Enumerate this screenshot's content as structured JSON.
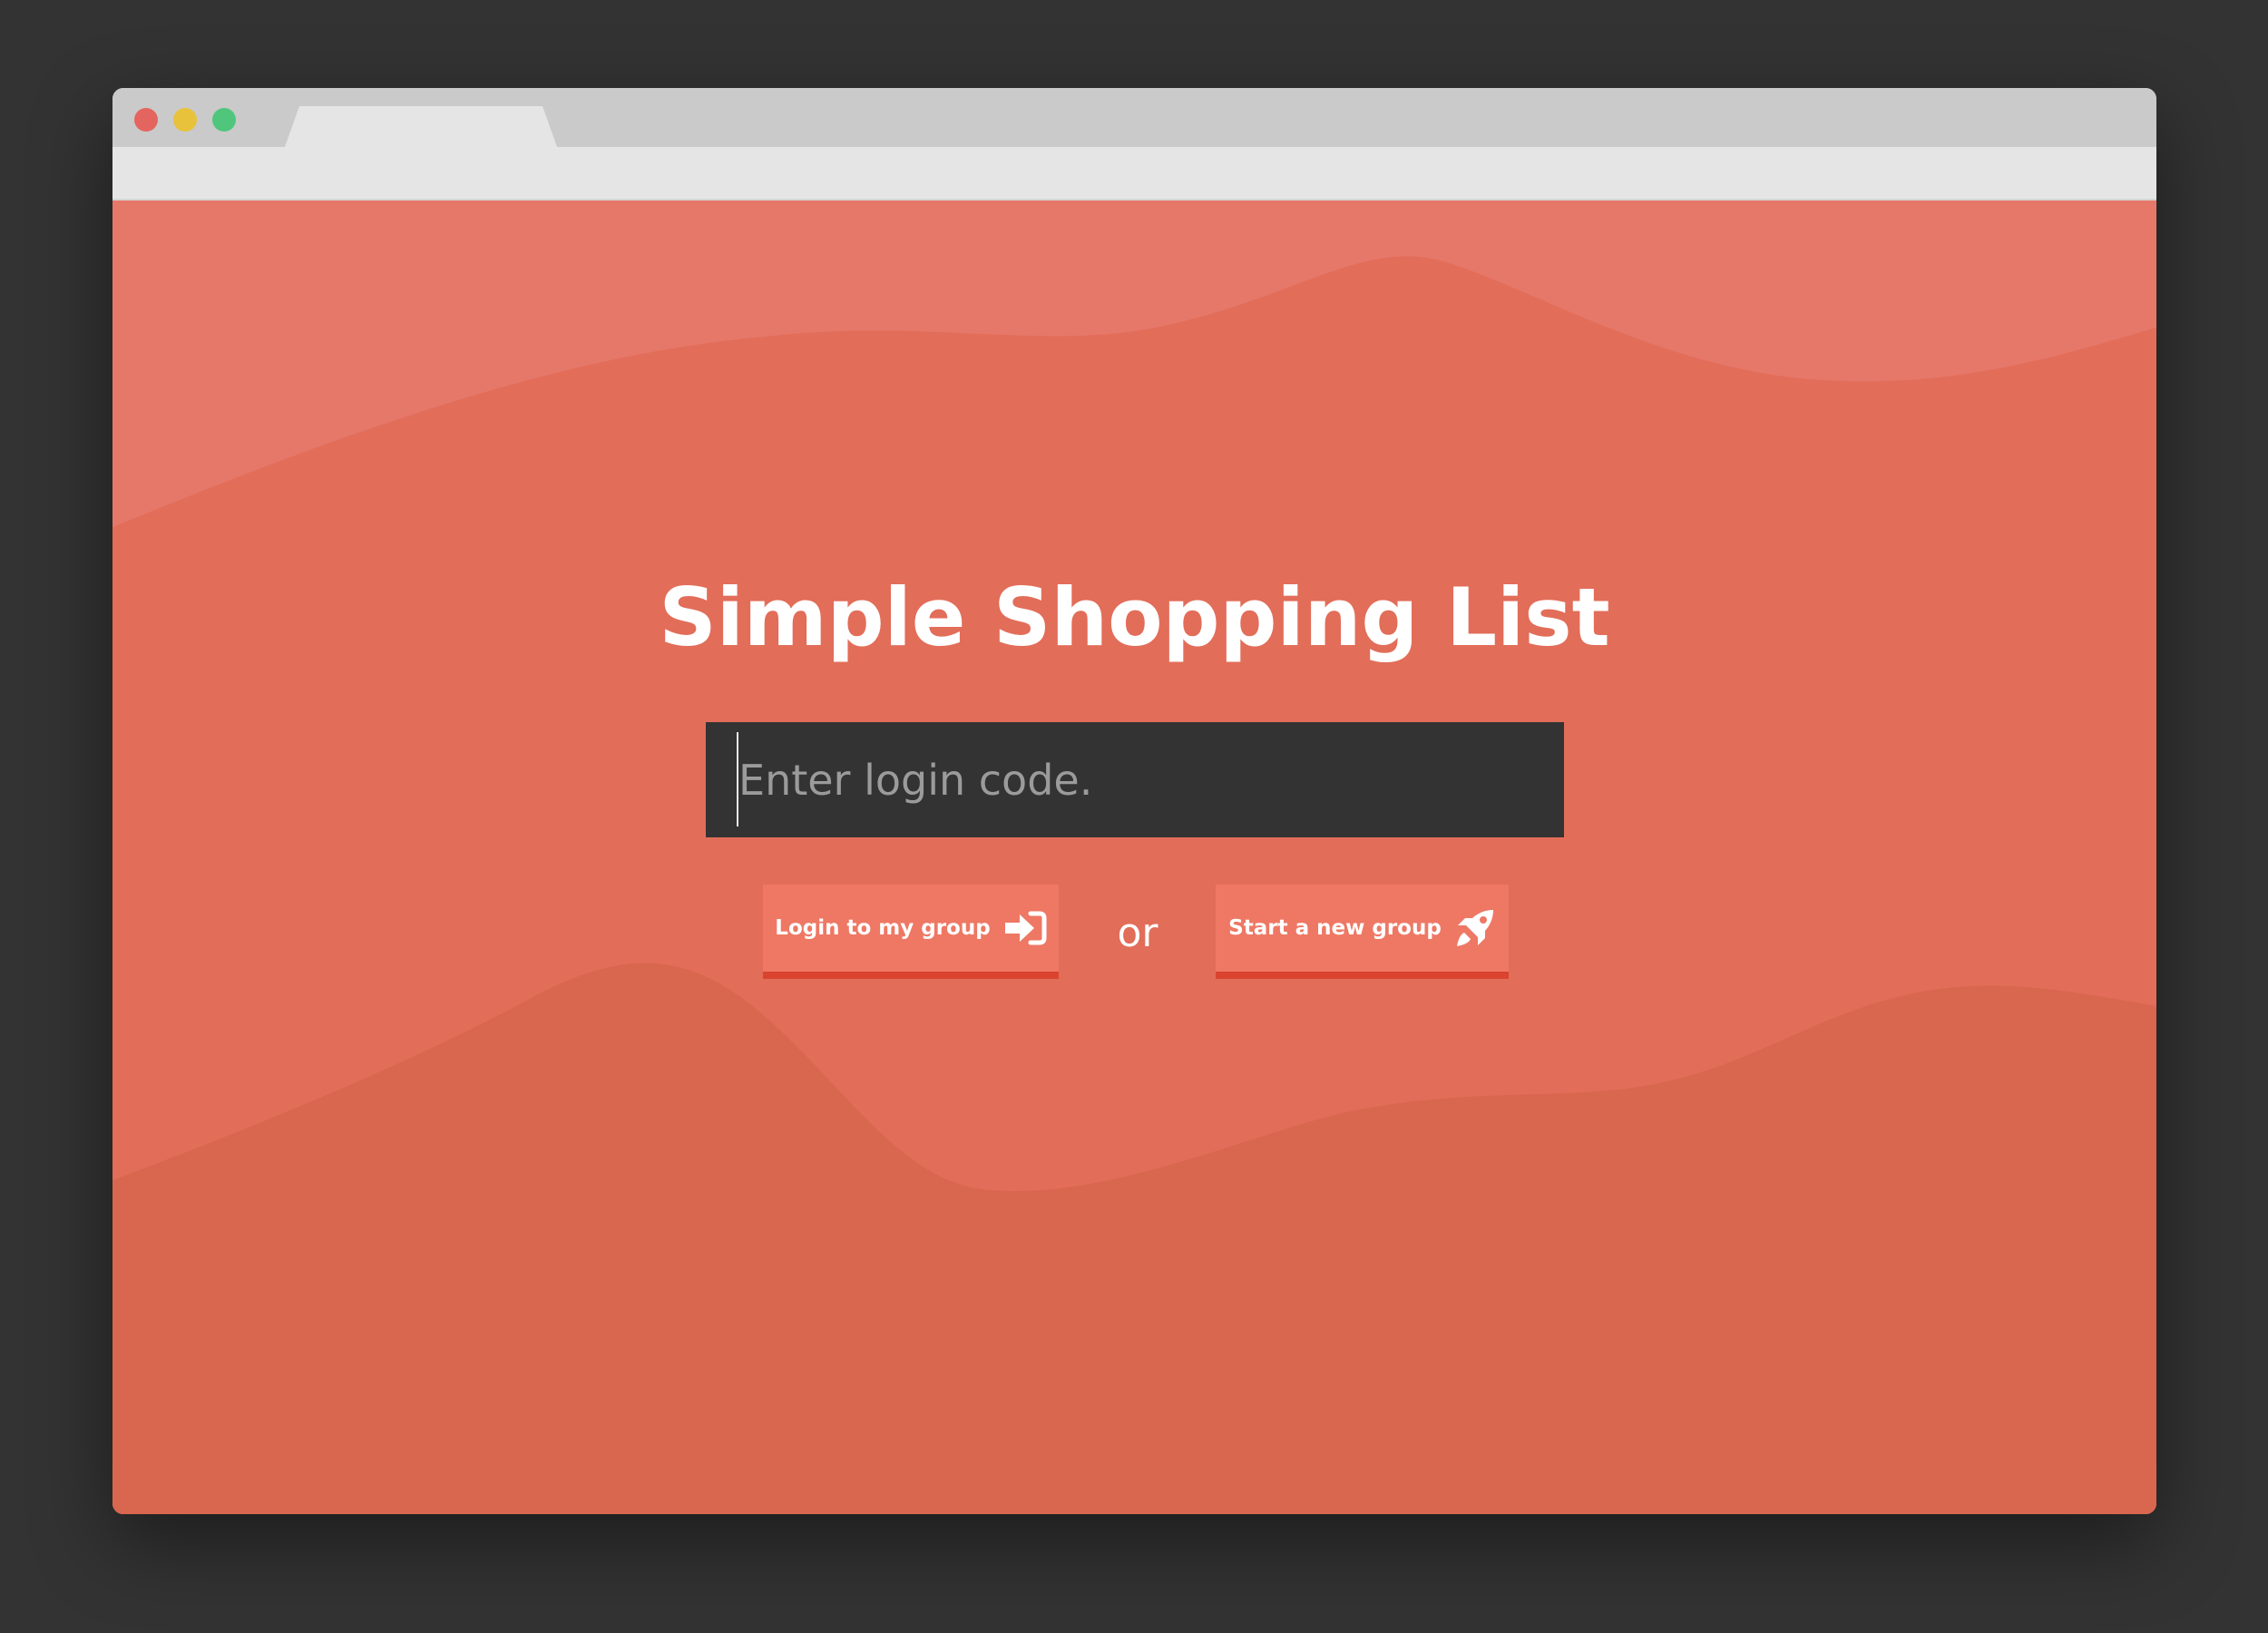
{
  "window": {
    "traffic_lights": [
      "close",
      "minimize",
      "zoom"
    ],
    "colors": {
      "close": "#e4655f",
      "minimize": "#e8c23a",
      "zoom": "#4fc67c"
    }
  },
  "page": {
    "title": "Simple Shopping List",
    "login_input": {
      "placeholder": "Enter login code.",
      "value": ""
    },
    "buttons": {
      "login_label": "Login to my group",
      "login_icon": "sign-in-icon",
      "separator": "or",
      "start_label": "Start a new group",
      "start_icon": "rocket-icon"
    },
    "colors": {
      "background": "#e2705b",
      "input_background": "#333333",
      "button": "#ee7864",
      "button_border": "#d9432f"
    }
  }
}
